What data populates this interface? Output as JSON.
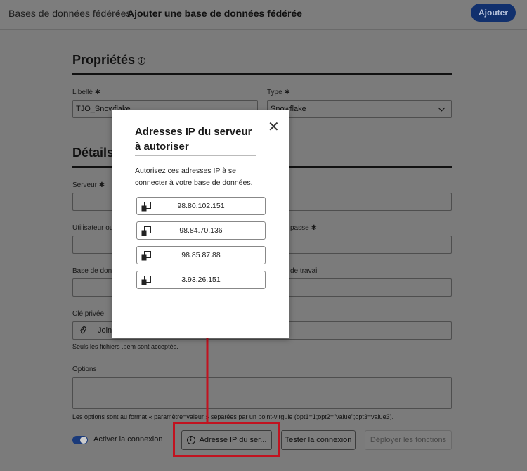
{
  "header": {
    "breadcrumb_parent": "Bases de données fédérées",
    "breadcrumb_separator": "›",
    "breadcrumb_current": "Ajouter une base de données fédérée",
    "add_button": "Ajouter"
  },
  "properties": {
    "title": "Propriétés",
    "label_field": {
      "label": "Libellé ✱",
      "value": "TJO_Snowflake"
    },
    "type_field": {
      "label": "Type ✱",
      "value": "Snowflake"
    }
  },
  "details": {
    "title": "Détails d",
    "server_label": "Serveur ✱",
    "user_label": "Utilisateur ou",
    "password_label": "passe ✱",
    "database_label": "Base de donn",
    "workspace_label": "de travail",
    "private_key_label": "Clé privée",
    "attach_label": "Joinc",
    "private_key_help": "Seuls les fichiers .pem sont acceptés.",
    "options_label": "Options",
    "options_help": "Les options sont au format « paramètre=valeur » séparées par un point-virgule (opt1=1;opt2=\"value\";opt3=value3)."
  },
  "footer": {
    "toggle_label": "Activer la connexion",
    "ip_button": "Adresse IP du ser...",
    "test_button": "Tester la connexion",
    "deploy_button": "Déployer les fonctions"
  },
  "dialog": {
    "title": "Adresses IP du serveur à autoriser",
    "close": "✕",
    "description": "Autorisez ces adresses IP à se connecter à votre base de données.",
    "ips": [
      "98.80.102.151",
      "98.84.70.136",
      "98.85.87.88",
      "3.93.26.151"
    ]
  },
  "colors": {
    "annotation_red": "#c1121f",
    "primary_button": "#11306d"
  },
  "icons": [
    "info-icon",
    "chevron-down-icon",
    "close-icon",
    "copy-icon",
    "paperclip-icon"
  ]
}
